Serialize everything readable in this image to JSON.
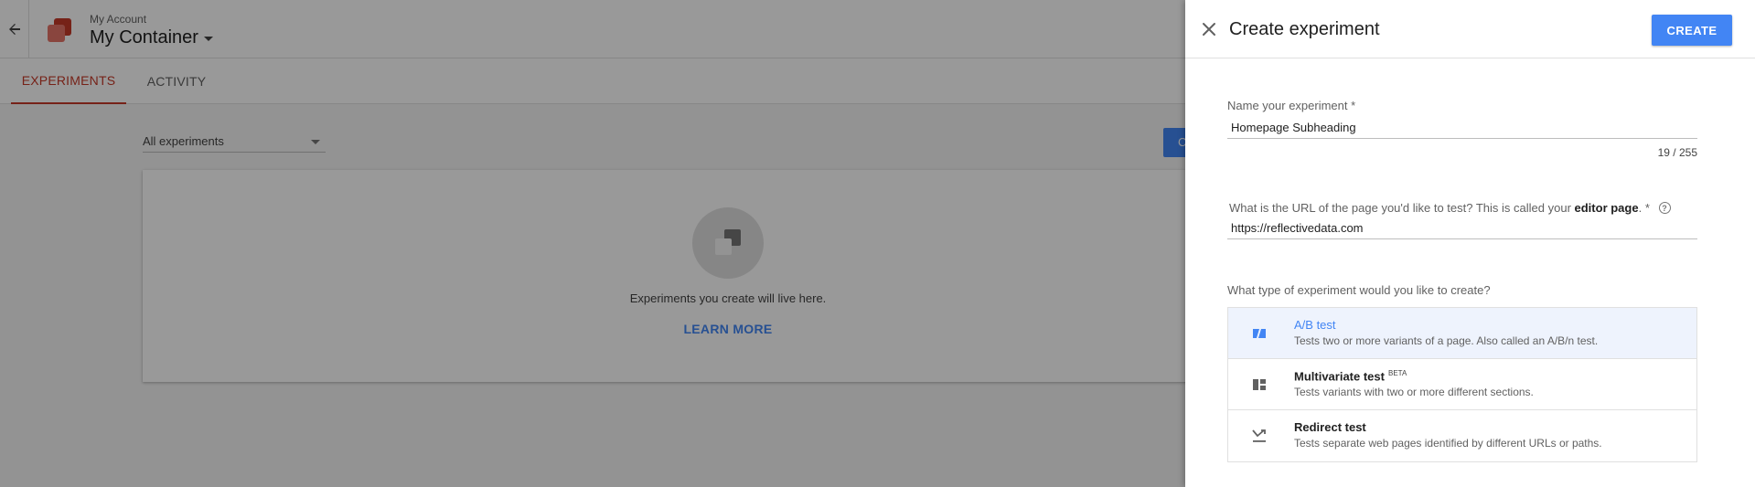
{
  "background": {
    "account_label": "My Account",
    "container_name": "My Container",
    "tabs": [
      {
        "label": "EXPERIMENTS",
        "active": true
      },
      {
        "label": "ACTIVITY",
        "active": false
      }
    ],
    "filter": {
      "selected": "All experiments"
    },
    "create_button_label": "C",
    "empty_state": {
      "message": "Experiments you create will live here.",
      "link": "LEARN MORE"
    }
  },
  "panel": {
    "title": "Create experiment",
    "create_label": "CREATE",
    "name_field": {
      "label": "Name your experiment *",
      "value": "Homepage Subheading",
      "counter": "19 / 255"
    },
    "url_field": {
      "label_pre": "What is the URL of the page you'd like to test? This is called your ",
      "label_bold": "editor page",
      "label_post": ". *",
      "value": "https://reflectivedata.com"
    },
    "type_question": "What type of experiment would you like to create?",
    "types": [
      {
        "name": "A/B test",
        "description": "Tests two or more variants of a page. Also called an A/B/n test.",
        "selected": true
      },
      {
        "name": "Multivariate test",
        "badge": "BETA",
        "description": "Tests variants with two or more different sections.",
        "selected": false
      },
      {
        "name": "Redirect test",
        "description": "Tests separate web pages identified by different URLs or paths.",
        "selected": false
      }
    ]
  },
  "colors": {
    "accent": "#4285f4",
    "tab_active": "#c53929",
    "overlay": "rgba(0,0,0,0.4)"
  }
}
